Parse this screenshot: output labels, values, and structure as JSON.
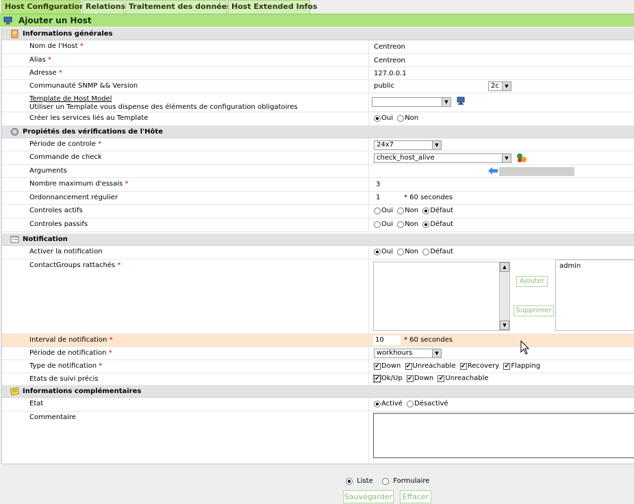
{
  "tabs": [
    {
      "label": "Host Configuration"
    },
    {
      "label": "Relations"
    },
    {
      "label": "Traitement des données"
    },
    {
      "label": "Host Extended Infos"
    }
  ],
  "header": {
    "title": "Ajouter un Host"
  },
  "sections": {
    "general": "Informations générales",
    "checks": "Propiétés des vérifications de l'Hôte",
    "notification": "Notification",
    "extra": "Informations complémentaires"
  },
  "fields": {
    "host_name": {
      "label": "Nom de l'Host",
      "value": "Centreon"
    },
    "alias": {
      "label": "Alias",
      "value": "Centreon"
    },
    "address": {
      "label": "Adresse",
      "value": "127.0.0.1"
    },
    "snmp": {
      "label": "Communauté SNMP && Version",
      "value": "public",
      "version": "2c"
    },
    "template": {
      "label": "Template de Host Model",
      "help": "Utiliser un Template vous dispense des éléments de configuration obligatoires"
    },
    "create_services": {
      "label": "Créer les services liés au Template",
      "opt_yes": "Oui",
      "opt_no": "Non"
    },
    "check_period": {
      "label": "Période de controle",
      "value": "24x7"
    },
    "check_command": {
      "label": "Commande de check",
      "value": "check_host_alive"
    },
    "arguments": {
      "label": "Arguments"
    },
    "max_attempts": {
      "label": "Nombre maximum d'essais",
      "value": "3"
    },
    "check_interval": {
      "label": "Ordonnancement régulier",
      "value": "1",
      "unit": "* 60 secondes"
    },
    "active_checks": {
      "label": "Controles actifs",
      "opt_yes": "Oui",
      "opt_no": "Non",
      "opt_default": "Défaut"
    },
    "passive_checks": {
      "label": "Controles passifs",
      "opt_yes": "Oui",
      "opt_no": "Non",
      "opt_default": "Défaut"
    },
    "notif_enabled": {
      "label": "Activer la notification",
      "opt_yes": "Oui",
      "opt_no": "Non",
      "opt_default": "Défaut"
    },
    "contactgroups": {
      "label": "ContactGroups rattachés",
      "add": "Ajouter",
      "remove": "Supprimer",
      "selected": [
        "admin"
      ]
    },
    "notif_interval": {
      "label": "Interval de notification",
      "value": "10",
      "unit": "* 60 secondes"
    },
    "notif_period": {
      "label": "Période de notification",
      "value": "workhours"
    },
    "notif_type": {
      "label": "Type de notification",
      "opts": [
        "Down",
        "Unreachable",
        "Recovery",
        "Flapping"
      ]
    },
    "stalking": {
      "label": "Etats de suivi précis",
      "opts": [
        "Ok/Up",
        "Down",
        "Unreachable"
      ]
    },
    "state": {
      "label": "Etat",
      "opt_on": "Activé",
      "opt_off": "Désactivé"
    },
    "comment": {
      "label": "Commentaire"
    }
  },
  "footer": {
    "opt_list": "Liste",
    "opt_form": "Formulaire",
    "save": "Sauvegarder",
    "clear": "Effacer"
  }
}
